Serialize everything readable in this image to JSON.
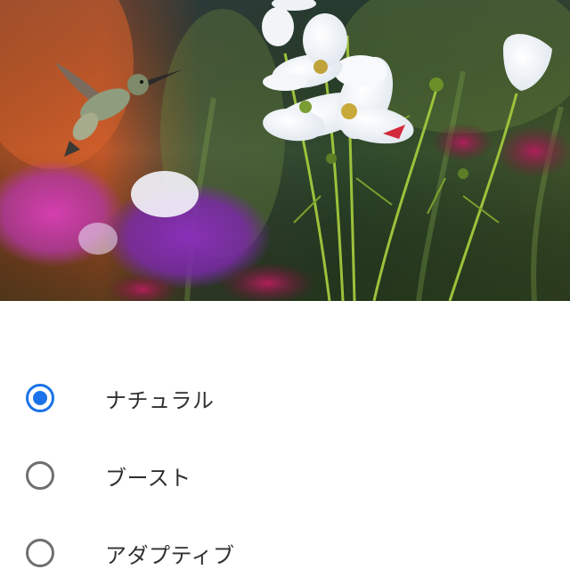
{
  "preview": {
    "image_description_icon": "hummingbird-and-cosmos-flowers-photo"
  },
  "color_modes": {
    "selected_index": 0,
    "options": [
      {
        "label": "ナチュラル",
        "selected": true
      },
      {
        "label": "ブースト",
        "selected": false
      },
      {
        "label": "アダプティブ",
        "selected": false
      }
    ]
  },
  "colors": {
    "accent": "#1a73e8",
    "radio_unselected": "#6f6f6f",
    "label_text": "#303030",
    "background": "#ffffff"
  }
}
